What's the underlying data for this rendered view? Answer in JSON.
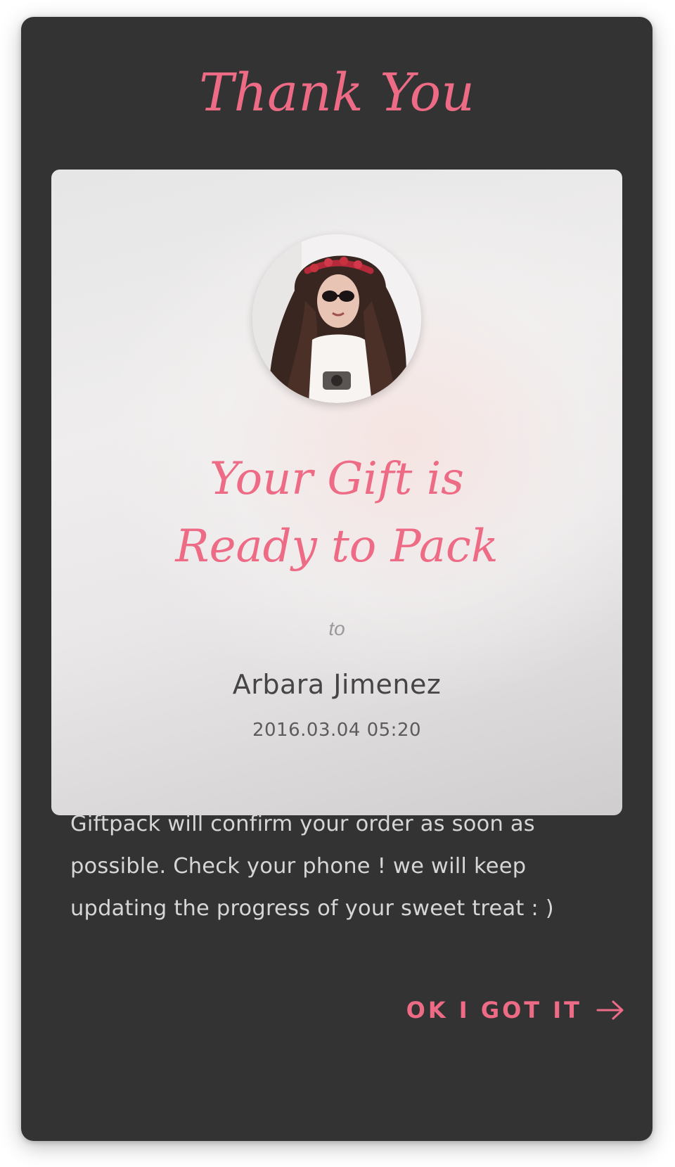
{
  "dialog": {
    "title": "Thank You"
  },
  "gift_card": {
    "avatar_icon": "user-photo",
    "headline_line1": "Your Gift is",
    "headline_line2": "Ready to Pack",
    "to_label": "to",
    "recipient_name": "Arbara Jimenez",
    "timestamp": "2016.03.04 05:20"
  },
  "message": "Giftpack will confirm your order as soon as possible. Check your phone ! we will keep updating the progress of your sweet treat : )",
  "confirm_button": {
    "label": "OK I GOT IT",
    "icon": "arrow-right-icon"
  },
  "colors": {
    "accent": "#ee6b86",
    "dialog_background": "#333333",
    "card_background": "#ececec"
  }
}
